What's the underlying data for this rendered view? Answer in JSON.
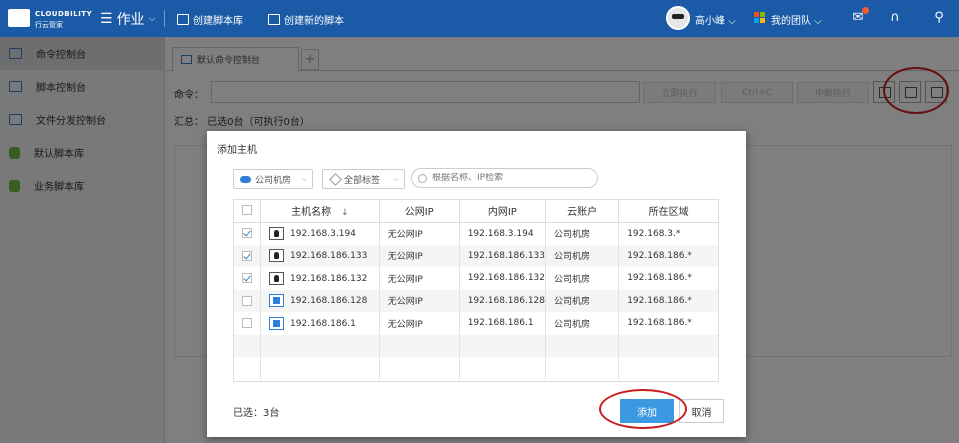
{
  "topbar": {
    "brand": "CLOUDBILITY",
    "brand_sub": "行云管家",
    "menu_label": "作业",
    "create_repo": "创建脚本库",
    "create_script": "创建新的脚本",
    "user_name": "高小峰",
    "team_label": "我的团队"
  },
  "sidebar": {
    "items": [
      {
        "label": "命令控制台"
      },
      {
        "label": "脚本控制台"
      },
      {
        "label": "文件分发控制台"
      },
      {
        "label": "默认脚本库"
      },
      {
        "label": "业务脚本库"
      }
    ]
  },
  "main": {
    "tab_label": "默认命令控制台",
    "tab_add": "+",
    "command_label": "命令：",
    "btn_run": "立即执行",
    "btn_ctrlc": "Ctrl+C",
    "btn_stop": "中断执行",
    "summary": "汇总：  已选0台（可执行0台）"
  },
  "modal": {
    "title": "添加主机",
    "filter_room": "公司机房",
    "filter_tags": "全部标签",
    "search_placeholder": "根据名称、IP检索",
    "columns": [
      "主机名称",
      "公网IP",
      "内网IP",
      "云账户",
      "所在区域"
    ],
    "sort_icon": "↓",
    "rows": [
      {
        "checked": true,
        "os": "linux",
        "name": "192.168.3.194",
        "public_ip": "无公网IP",
        "private_ip": "192.168.3.194",
        "account": "公司机房",
        "region": "192.168.3.*"
      },
      {
        "checked": true,
        "os": "linux",
        "name": "192.168.186.133",
        "public_ip": "无公网IP",
        "private_ip": "192.168.186.133",
        "account": "公司机房",
        "region": "192.168.186.*"
      },
      {
        "checked": true,
        "os": "linux",
        "name": "192.168.186.132",
        "public_ip": "无公网IP",
        "private_ip": "192.168.186.132",
        "account": "公司机房",
        "region": "192.168.186.*"
      },
      {
        "checked": false,
        "os": "windows",
        "name": "192.168.186.128",
        "public_ip": "无公网IP",
        "private_ip": "192.168.186.128",
        "account": "公司机房",
        "region": "192.168.186.*"
      },
      {
        "checked": false,
        "os": "windows",
        "name": "192.168.186.1",
        "public_ip": "无公网IP",
        "private_ip": "192.168.186.1",
        "account": "公司机房",
        "region": "192.168.186.*"
      }
    ],
    "selected_count": "已选：3台",
    "btn_add": "添加",
    "btn_cancel": "取消"
  },
  "colors": {
    "header_bg": "#1a5aa6",
    "accent": "#3a99e0",
    "highlight": "#c81e1e"
  }
}
